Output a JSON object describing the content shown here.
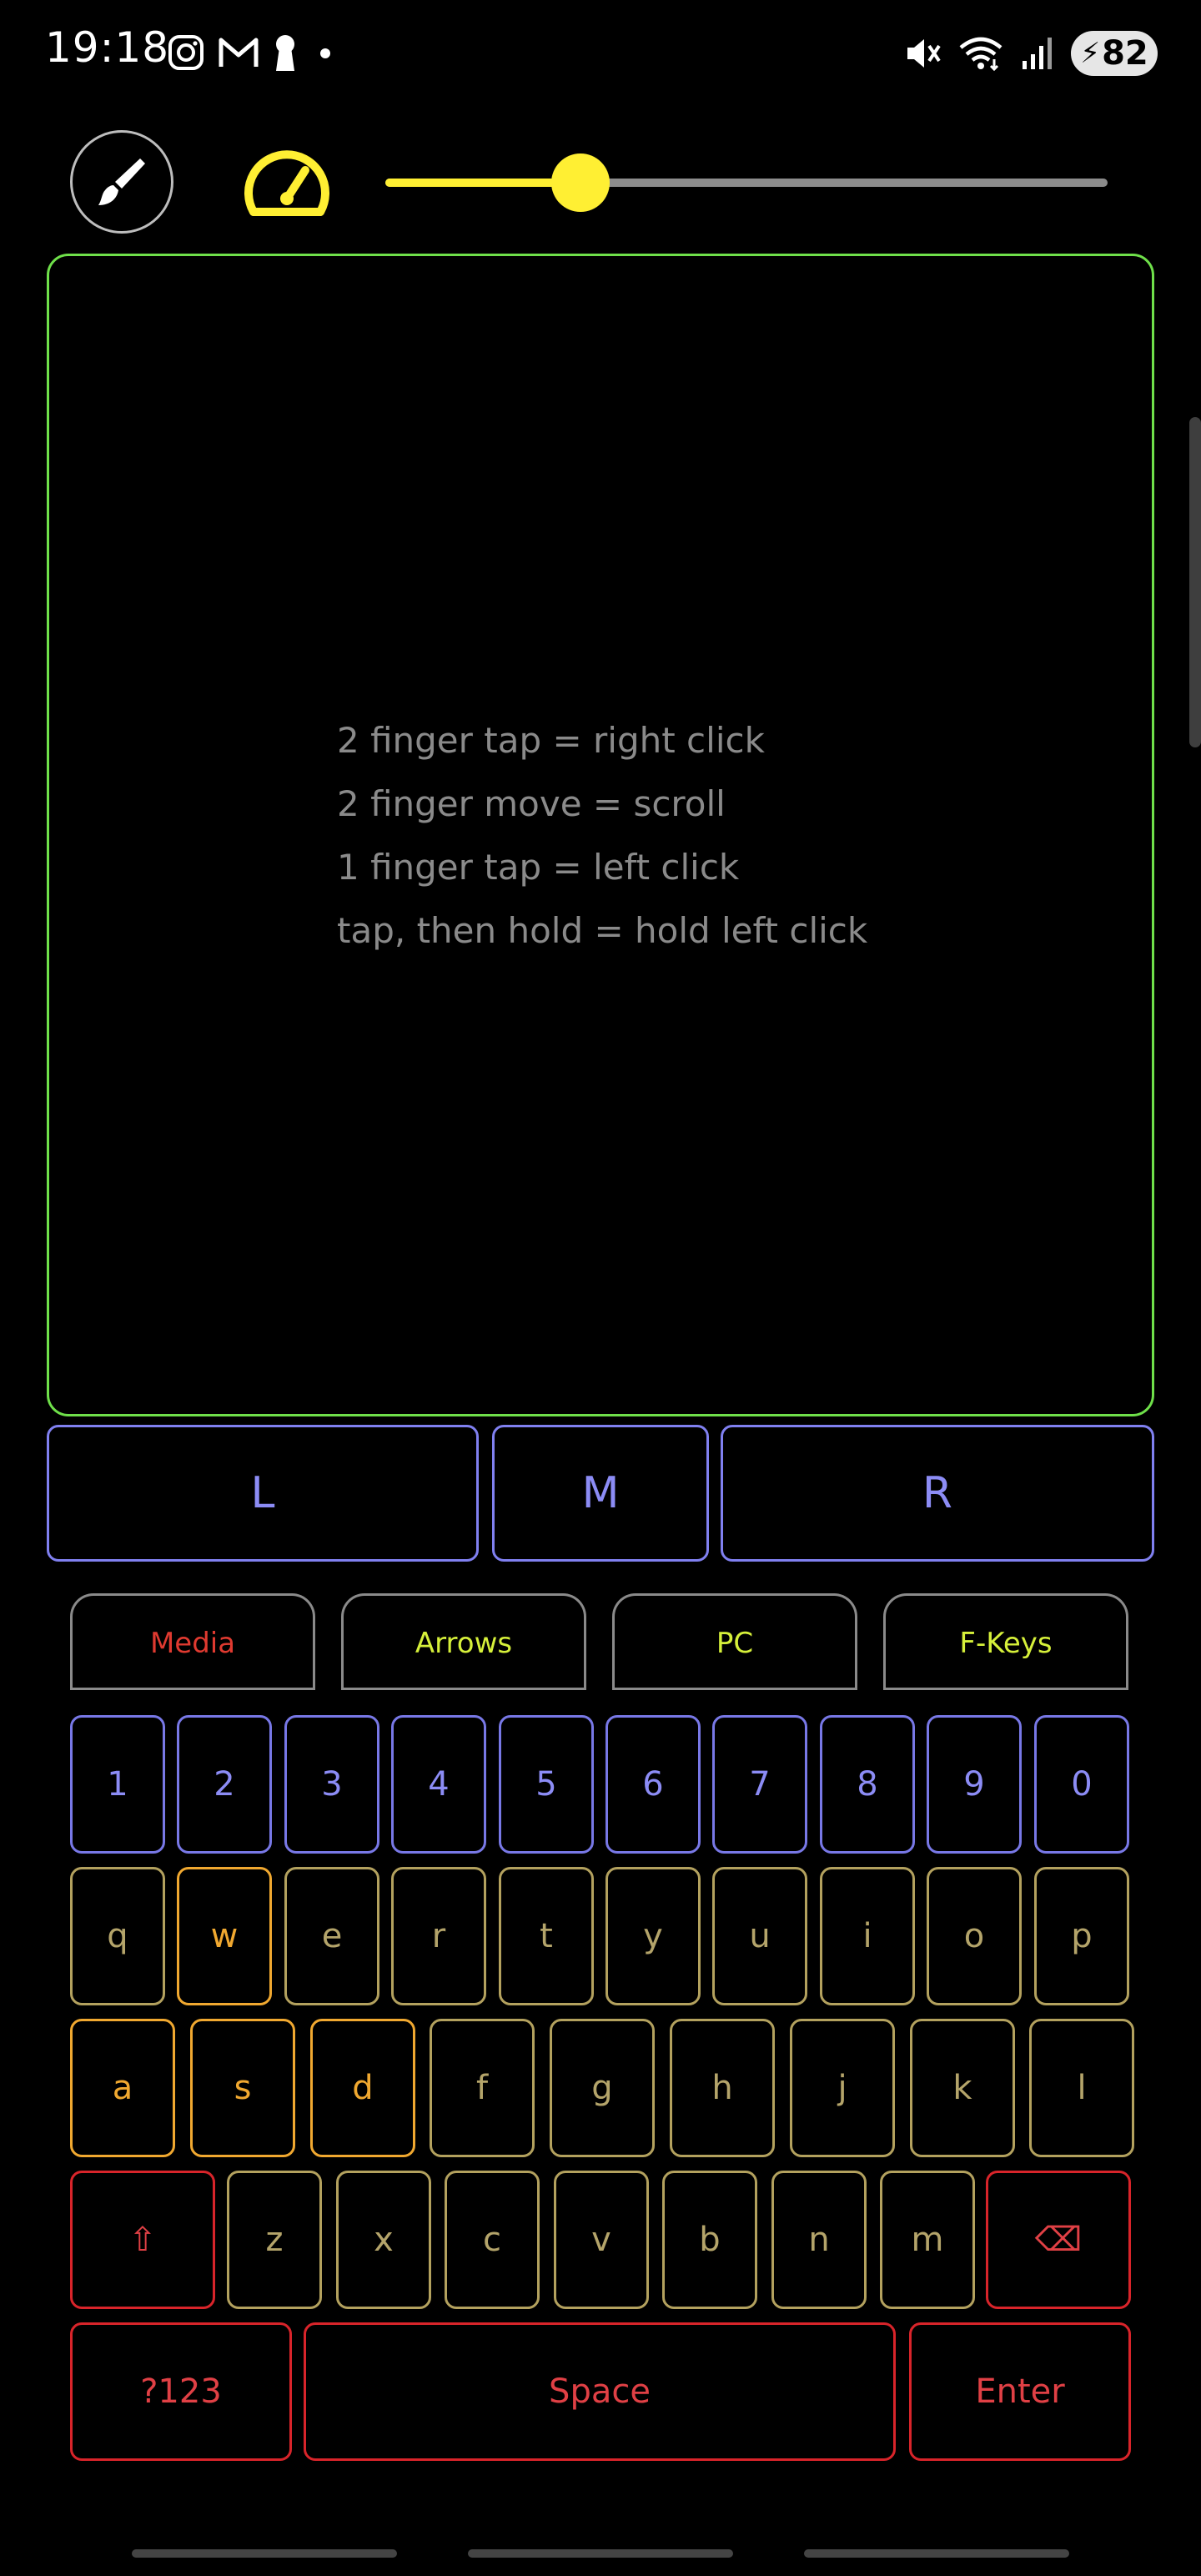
{
  "status_bar": {
    "time": "19:18",
    "app_icons": [
      "instagram-icon",
      "gmail-icon",
      "keyhole-icon",
      "dot-icon"
    ],
    "battery_level": "82"
  },
  "toolbar": {
    "slider_value": 0.27,
    "accent": "#ffef33"
  },
  "touchpad": {
    "border_color": "#6fe04a",
    "hints": [
      "2 finger tap = right click",
      "2 finger move = scroll",
      "1 finger tap = left click",
      "tap, then hold = hold left click"
    ]
  },
  "mouse_buttons": {
    "left": "L",
    "middle": "M",
    "right": "R"
  },
  "tabs": [
    {
      "label": "Media",
      "color": "#e03a30"
    },
    {
      "label": "Arrows",
      "color": "#d6f03a"
    },
    {
      "label": "PC",
      "color": "#d6f03a"
    },
    {
      "label": "F-Keys",
      "color": "#d6f03a"
    }
  ],
  "keyboard": {
    "numbers": [
      "1",
      "2",
      "3",
      "4",
      "5",
      "6",
      "7",
      "8",
      "9",
      "0"
    ],
    "row_q": [
      "q",
      "w",
      "e",
      "r",
      "t",
      "y",
      "u",
      "i",
      "o",
      "p"
    ],
    "row_a": [
      "a",
      "s",
      "d",
      "f",
      "g",
      "h",
      "j",
      "k",
      "l"
    ],
    "row_z": [
      "z",
      "x",
      "c",
      "v",
      "b",
      "n",
      "m"
    ],
    "shift": "⇧",
    "backspace": "⌫",
    "symbols": "?123",
    "space": "Space",
    "enter": "Enter"
  }
}
